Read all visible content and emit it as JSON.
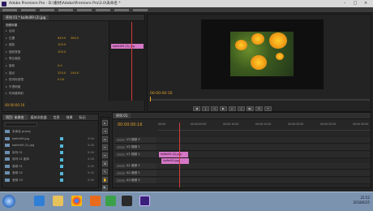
{
  "window": {
    "title": "Adobe Premiere Pro - D:\\素材\\Adobe\\Premiere Pro\\3.0\\未命名 *"
  },
  "effect_controls": {
    "tab_label": "效果控件",
    "clip_tab": "序列 01 * kaifei09 (2).jpg",
    "section_video": "视频效果",
    "rows": [
      {
        "label": "运动",
        "v1": "",
        "v2": ""
      },
      {
        "label": "位置",
        "v1": "640.0",
        "v2": "360.0"
      },
      {
        "label": "缩放",
        "v1": "100.0",
        "v2": ""
      },
      {
        "label": "缩放宽度",
        "v1": "100.0",
        "v2": ""
      },
      {
        "label": "等比缩放",
        "v1": "",
        "v2": ""
      },
      {
        "label": "旋转",
        "v1": "0.0",
        "v2": ""
      },
      {
        "label": "锚点",
        "v1": "320.0",
        "v2": "240.0"
      },
      {
        "label": "防闪烁滤镜",
        "v1": "0.00",
        "v2": ""
      },
      {
        "label": "不透明度",
        "v1": "",
        "v2": ""
      },
      {
        "label": "时间重映射",
        "v1": "",
        "v2": ""
      }
    ],
    "mini_clip_label": "kaifei09 (2).jpg",
    "timecode": "00:00:00:16"
  },
  "program_monitor": {
    "tab_label": "节目: 序列 01",
    "timecode": "00:00:00:16",
    "controls": [
      "◀",
      "|",
      "◁",
      "▶",
      "▷",
      "|",
      "▶|",
      "⊡",
      "+"
    ]
  },
  "project": {
    "tabs": [
      "项目: 未命名",
      "媒体浏览器",
      "信息",
      "效果",
      "标记"
    ],
    "items": [
      {
        "name": "未命名.prproj",
        "dur": ""
      },
      {
        "name": "kaifei09.jpg",
        "dur": "5:00"
      },
      {
        "name": "kaifei09 (2).jpg",
        "dur": "5:00"
      },
      {
        "name": "序列 01",
        "dur": "5:00"
      },
      {
        "name": "序列 01 副本",
        "dur": "5:00"
      },
      {
        "name": "音频 01",
        "dur": "5:00"
      },
      {
        "name": "音频 02",
        "dur": "5:00"
      },
      {
        "name": "音频 03",
        "dur": "5:00"
      }
    ]
  },
  "tools": [
    "▸",
    "⇥",
    "⇔",
    "✂",
    "↔",
    "⊞",
    "✎",
    "✋",
    "🔍"
  ],
  "timeline": {
    "tab_label": "序列 01",
    "timecode": "00:00:00:16",
    "ruler": [
      "00:00",
      "00:00:05:00",
      "00:00:10:00",
      "00:00:15:00",
      "00:00:20:00",
      "00:00:25:00",
      "00:00:30:00"
    ],
    "tracks": [
      {
        "name": "V3",
        "label": "视频 3"
      },
      {
        "name": "V2",
        "label": "视频 2"
      },
      {
        "name": "V1",
        "label": "视频 1"
      },
      {
        "name": "A1",
        "label": "音频 1"
      },
      {
        "name": "A2",
        "label": "音频 2"
      },
      {
        "name": "A3",
        "label": "音频 3"
      }
    ],
    "clips": [
      {
        "label": "kaifei09 (2).jpg",
        "color": "#d477c6"
      },
      {
        "label": "kaifei09.jpg",
        "color": "#d477c6"
      }
    ]
  },
  "taskbar": {
    "time": "22:52",
    "date": "2018/6/25"
  }
}
